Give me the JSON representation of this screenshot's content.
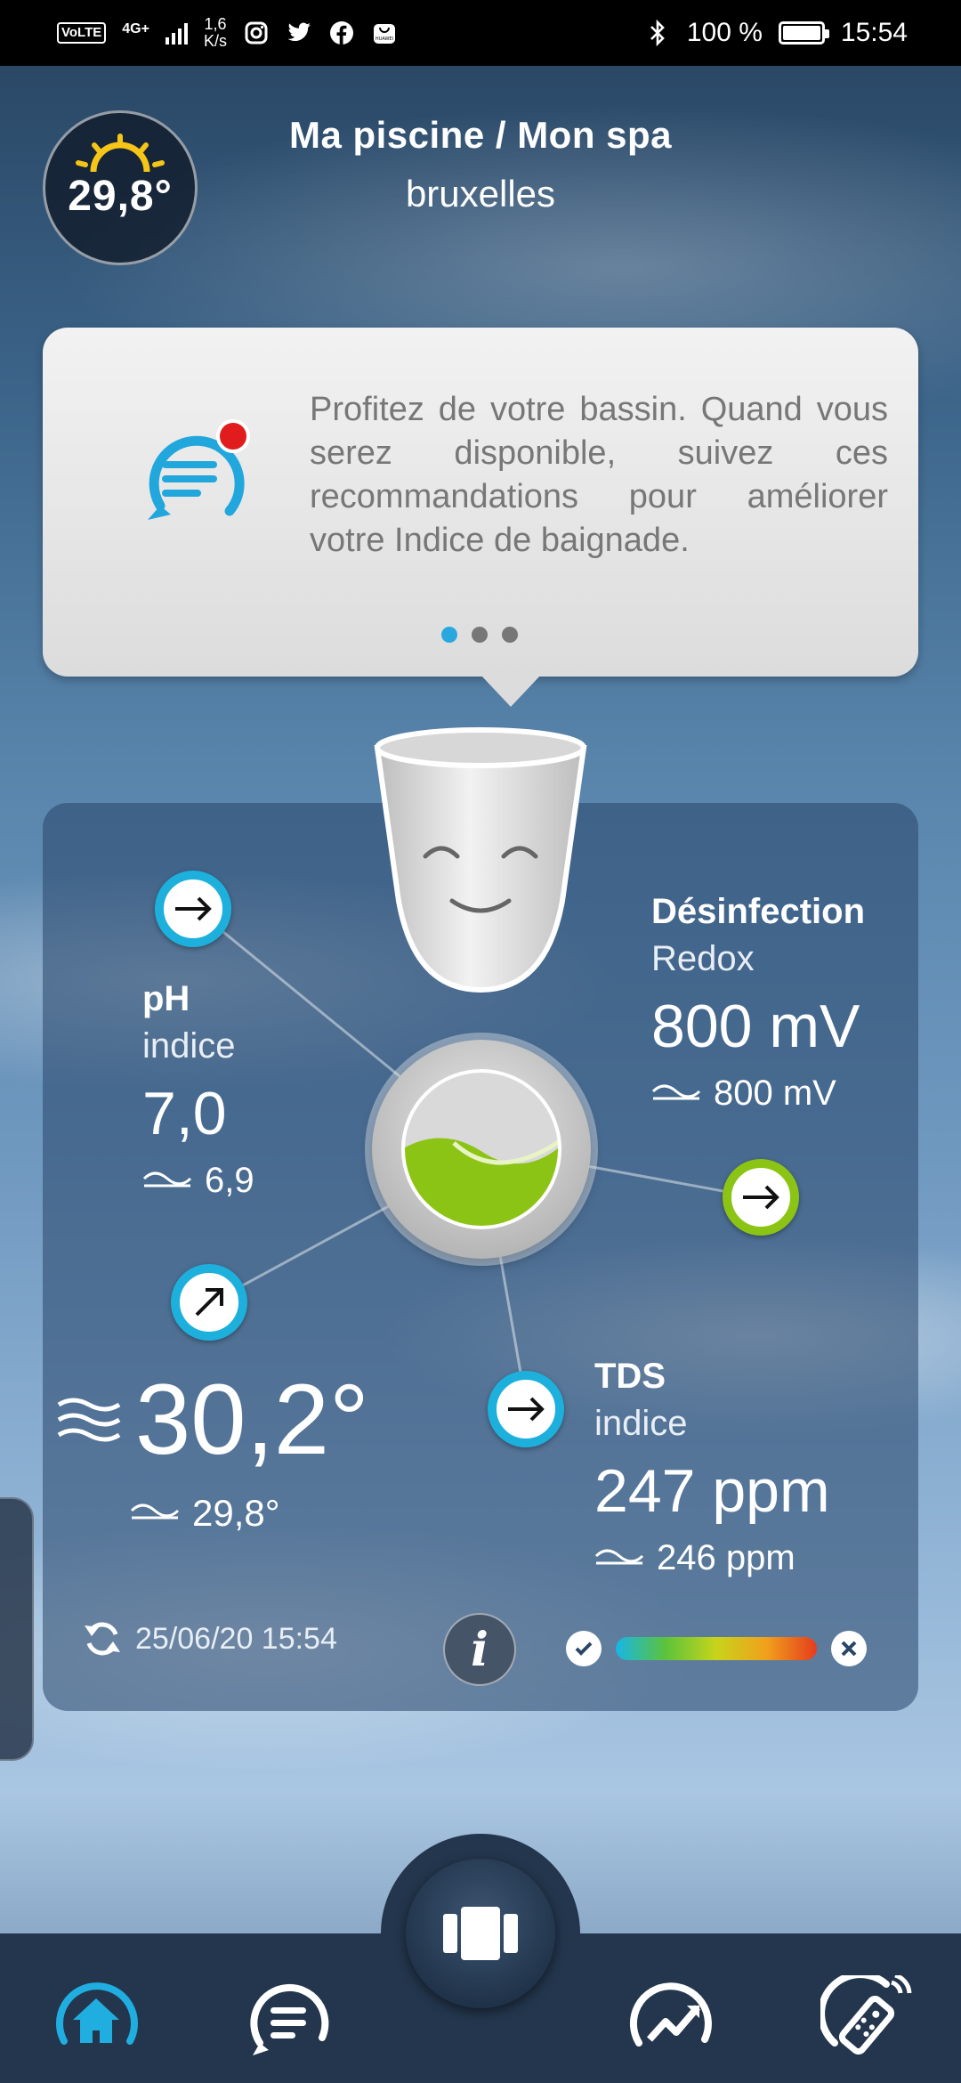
{
  "statusbar": {
    "volte": "VoLTE",
    "network": "4G+",
    "speed": "1,6\nK/s",
    "battery": "100 %",
    "time": "15:54"
  },
  "header": {
    "weather_temp": "29,8°",
    "title": "Ma piscine / Mon spa",
    "city": "bruxelles"
  },
  "card": {
    "message": "Profitez de votre bassin. Quand vous serez disponible, suivez ces recommandations pour améliorer votre Indice de baignade.",
    "pages": 3,
    "active_page": 1
  },
  "metrics": {
    "ph": {
      "title": "pH",
      "sub": "indice",
      "value": "7,0",
      "avg": "6,9"
    },
    "disinfection": {
      "title": "Désinfection",
      "sub": "Redox",
      "value": "800 mV",
      "avg": "800 mV"
    },
    "tds": {
      "title": "TDS",
      "sub": "indice",
      "value": "247 ppm",
      "avg": "246 ppm"
    },
    "temperature": {
      "value": "30,2°",
      "avg": "29,8°"
    }
  },
  "footer": {
    "timestamp": "25/06/20 15:54"
  },
  "colors": {
    "accent": "#1eb0dc",
    "green": "#8cc415",
    "nav": "#23364d"
  },
  "nav": [
    "home-icon",
    "messages-icon",
    "central-device-icon",
    "trend-icon",
    "remote-control-icon"
  ]
}
